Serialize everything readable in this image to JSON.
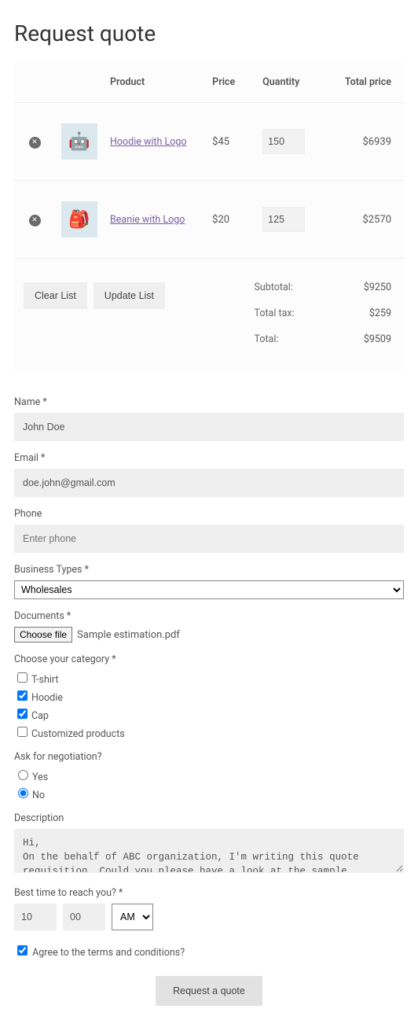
{
  "title": "Request quote",
  "table": {
    "headers": {
      "product": "Product",
      "price": "Price",
      "qty": "Quantity",
      "total": "Total price"
    },
    "rows": [
      {
        "thumb": "🤖",
        "name": "Hoodie with Logo",
        "price": "$45",
        "qty": "150",
        "total": "$6939"
      },
      {
        "thumb": "🎒",
        "name": "Beanie with Logo",
        "price": "$20",
        "qty": "125",
        "total": "$2570"
      }
    ],
    "buttons": {
      "clear": "Clear List",
      "update": "Update List"
    },
    "totals": {
      "subtotal_label": "Subtotal:",
      "subtotal": "$9250",
      "tax_label": "Total tax:",
      "tax": "$259",
      "total_label": "Total:",
      "total": "$9509"
    }
  },
  "form": {
    "name_label": "Name *",
    "name_value": "John Doe",
    "email_label": "Email *",
    "email_value": "doe.john@gmail.com",
    "phone_label": "Phone",
    "phone_ph": "Enter phone",
    "biztype_label": "Business Types *",
    "biztype_value": "Wholesales",
    "docs_label": "Documents *",
    "file_btn": "Choose file",
    "file_name": "Sample estimation.pdf",
    "cat_label": "Choose your category *",
    "cats": {
      "tshirt": "T-shirt",
      "hoodie": "Hoodie",
      "cap": "Cap",
      "custom": "Customized products"
    },
    "neg_label": "Ask for negotiation?",
    "neg_yes": "Yes",
    "neg_no": "No",
    "desc_label": "Description",
    "desc_value": "Hi,\nOn the behalf of ABC organization, I'm writing this quote requisition. Could you please have a look at the sample",
    "time_label": "Best time to reach you? *",
    "time_h": "10",
    "time_m": "00",
    "time_ampm": "AM",
    "agree_label": "Agree to the terms and conditions?",
    "submit": "Request a quote"
  }
}
